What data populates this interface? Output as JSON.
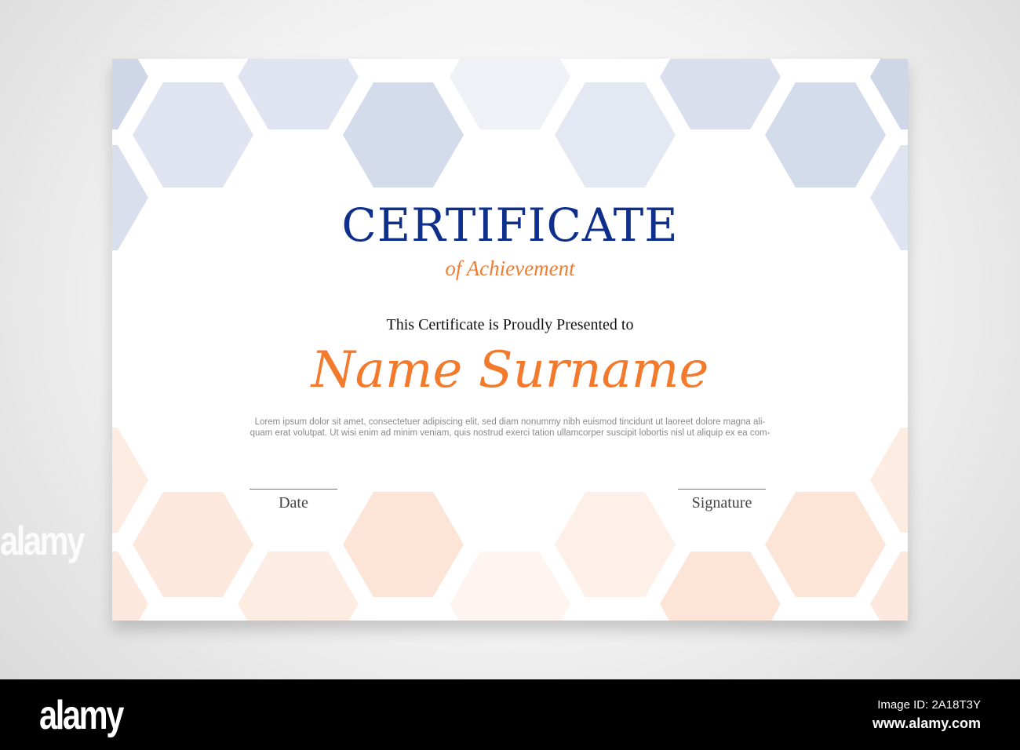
{
  "certificate": {
    "title": "CERTIFICATE",
    "subtitle": "of Achievement",
    "presented_text": "This Certificate is Proudly Presented to",
    "recipient_name": "Name Surname",
    "body_lines": [
      "Lorem ipsum dolor sit amet, consectetuer adipiscing elit, sed diam nonummy nibh euismod tincidunt ut laoreet dolore magna ali-",
      "quam erat volutpat. Ut wisi enim ad minim veniam, quis nostrud exerci tation ullamcorper suscipit lobortis nisl ut aliquip ex ea com-"
    ],
    "date_label": "Date",
    "signature_label": "Signature"
  },
  "colors": {
    "title": "#0f2f8c",
    "accent": "#f37a2c",
    "hex_blue": "#c9d2e6",
    "hex_orange": "#fbd9c6"
  },
  "watermark": "alamy",
  "footer": {
    "logo": "alamy",
    "image_id": "Image ID: 2A18T3Y",
    "website": "www.alamy.com"
  }
}
